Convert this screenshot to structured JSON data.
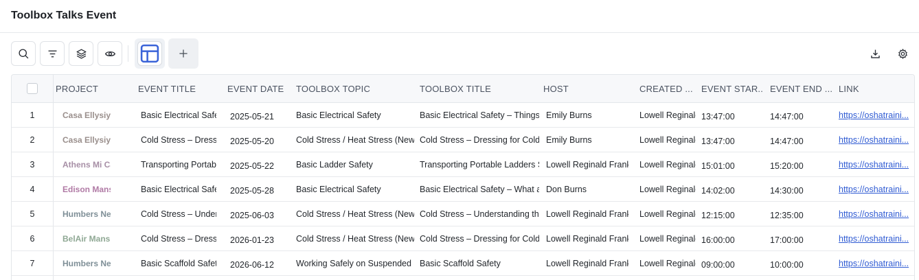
{
  "header": {
    "title": "Toolbox Talks Event"
  },
  "toolbar": {
    "buttons": [
      "search-icon",
      "filter-icon",
      "layers-icon",
      "eye-icon",
      "table-view-icon",
      "plus-icon"
    ],
    "right_buttons": [
      "download-icon",
      "gear-icon"
    ]
  },
  "table": {
    "columns": [
      "PROJECT",
      "EVENT TITLE",
      "EVENT DATE",
      "TOOLBOX TOPIC",
      "TOOLBOX TITLE",
      "HOST",
      "CREATED ...",
      "EVENT STAR...",
      "EVENT END ...",
      "LINK"
    ],
    "rows": [
      {
        "num": "1",
        "project": "Casa Ellysiyun",
        "project_color": "#9a8f8c",
        "event_title": "Basic Electrical Safety",
        "event_date": "2025-05-21",
        "topic": "Basic Electrical Safety",
        "toolbox_title": "Basic Electrical Safety – Things to",
        "host": "Emily Burns",
        "created": "Lowell Reginald",
        "start": "13:47:00",
        "end": "14:47:00",
        "link": "https://oshatraini..."
      },
      {
        "num": "2",
        "project": "Casa Ellysiyun",
        "project_color": "#9a8f8c",
        "event_title": "Cold Stress – Dressing",
        "event_date": "2025-05-20",
        "topic": "Cold Stress / Heat Stress (New fo",
        "toolbox_title": "Cold Stress – Dressing for Cold W",
        "host": "Emily Burns",
        "created": "Lowell Reginald",
        "start": "13:47:00",
        "end": "14:47:00",
        "link": "https://oshatraini..."
      },
      {
        "num": "3",
        "project": "Athens Mi Cas",
        "project_color": "#a78fa6",
        "event_title": "Transporting Portable",
        "event_date": "2025-05-22",
        "topic": "Basic Ladder Safety",
        "toolbox_title": "Transporting Portable Ladders Sa",
        "host": "Lowell Reginald Frankli",
        "created": "Lowell Reginald",
        "start": "15:01:00",
        "end": "15:20:00",
        "link": "https://oshatraini..."
      },
      {
        "num": "4",
        "project": "Edison Mansic",
        "project_color": "#b07aa5",
        "event_title": "Basic Electrical Safety",
        "event_date": "2025-05-28",
        "topic": "Basic Electrical Safety",
        "toolbox_title": "Basic Electrical Safety – What are",
        "host": "Don Burns",
        "created": "Lowell Reginald",
        "start": "14:02:00",
        "end": "14:30:00",
        "link": "https://oshatraini..."
      },
      {
        "num": "5",
        "project": "Humbers Ne",
        "project_color": "#7f8f97",
        "event_title": "Cold Stress – Unders",
        "event_date": "2025-06-03",
        "topic": "Cold Stress / Heat Stress (New fo",
        "toolbox_title": "Cold Stress – Understanding the",
        "host": "Lowell Reginald Frankli",
        "created": "Lowell Reginald",
        "start": "12:15:00",
        "end": "12:35:00",
        "link": "https://oshatraini..."
      },
      {
        "num": "6",
        "project": "BelAir Mansior",
        "project_color": "#8fa894",
        "event_title": "Cold Stress – Dressing",
        "event_date": "2026-01-23",
        "topic": "Cold Stress / Heat Stress (New fo",
        "toolbox_title": "Cold Stress – Dressing for Cold W",
        "host": "Lowell Reginald Frankli",
        "created": "Lowell Reginald",
        "start": "16:00:00",
        "end": "17:00:00",
        "link": "https://oshatraini..."
      },
      {
        "num": "7",
        "project": "Humbers Ne",
        "project_color": "#7f8f97",
        "event_title": "Basic Scaffold Safety",
        "event_date": "2026-06-12",
        "topic": "Working Safely on Suspended Sc",
        "toolbox_title": "Basic Scaffold Safety",
        "host": "Lowell Reginald Frankli",
        "created": "Lowell Reginald",
        "start": "09:00:00",
        "end": "10:00:00",
        "link": "https://oshatraini..."
      }
    ]
  }
}
